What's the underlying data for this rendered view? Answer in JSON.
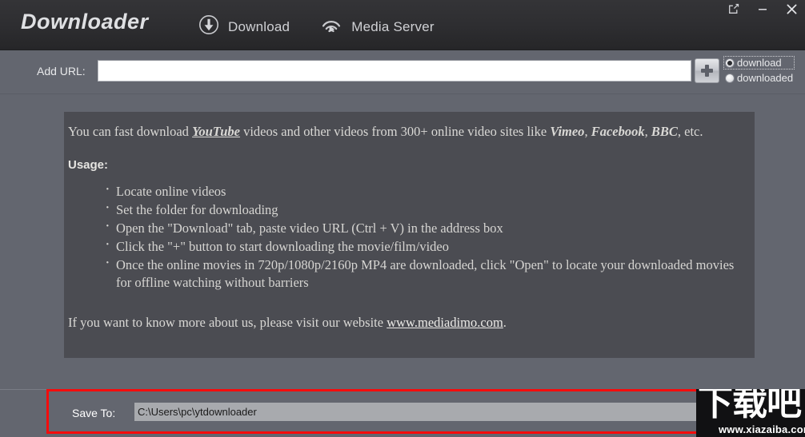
{
  "window": {
    "brand": "Downloader",
    "controls": [
      {
        "name": "restore-window-button",
        "icon": "external-link-icon",
        "label": "↗"
      },
      {
        "name": "minimize-window-button",
        "icon": "minimize-icon",
        "label": "—"
      },
      {
        "name": "close-window-button",
        "icon": "close-icon",
        "label": "✕"
      }
    ]
  },
  "tabs": [
    {
      "label": "Download",
      "icon": "download-circle-icon"
    },
    {
      "label": "Media Server",
      "icon": "broadcast-play-icon"
    }
  ],
  "urlbar": {
    "label": "Add URL:",
    "value": "",
    "placeholder": "",
    "add_button_icon": "plus-icon",
    "radios": [
      {
        "label": "download",
        "selected": true,
        "focused": true
      },
      {
        "label": "downloaded",
        "selected": false,
        "focused": false
      }
    ]
  },
  "panel": {
    "intro": {
      "pre": "You can fast download ",
      "site1": "YouTube",
      "mid": " videos and other videos from 300+ online video sites like ",
      "site2": "Vimeo",
      "sep1": ", ",
      "site3": "Facebook",
      "sep2": ", ",
      "site4": "BBC",
      "post": ", etc."
    },
    "usage_heading": "Usage:",
    "steps": [
      "Locate online videos",
      "Set the folder for downloading",
      "Open the \"Download\" tab, paste video URL (Ctrl + V) in the address box",
      "Click the \"+\" button to start downloading the movie/film/video",
      "Once the online movies in 720p/1080p/2160p MP4 are downloaded, click \"Open\" to locate your downloaded movies for offline watching without barriers"
    ],
    "outro": {
      "pre": "If you want to know more about us, please visit our website ",
      "link": "www.mediadimo.com",
      "post": "."
    }
  },
  "saveto": {
    "label": "Save To:",
    "value": "C:\\Users\\pc\\ytdownloader"
  },
  "watermark": {
    "cjk": "下载吧",
    "url": "www.xiazaiba.com"
  },
  "colors": {
    "window_bg": "#63666f",
    "titlebar_bg": "#2e2e31",
    "panel_bg": "#4b4c52",
    "annotation_red": "#f40c0c",
    "text_light": "#d9d8d5"
  }
}
